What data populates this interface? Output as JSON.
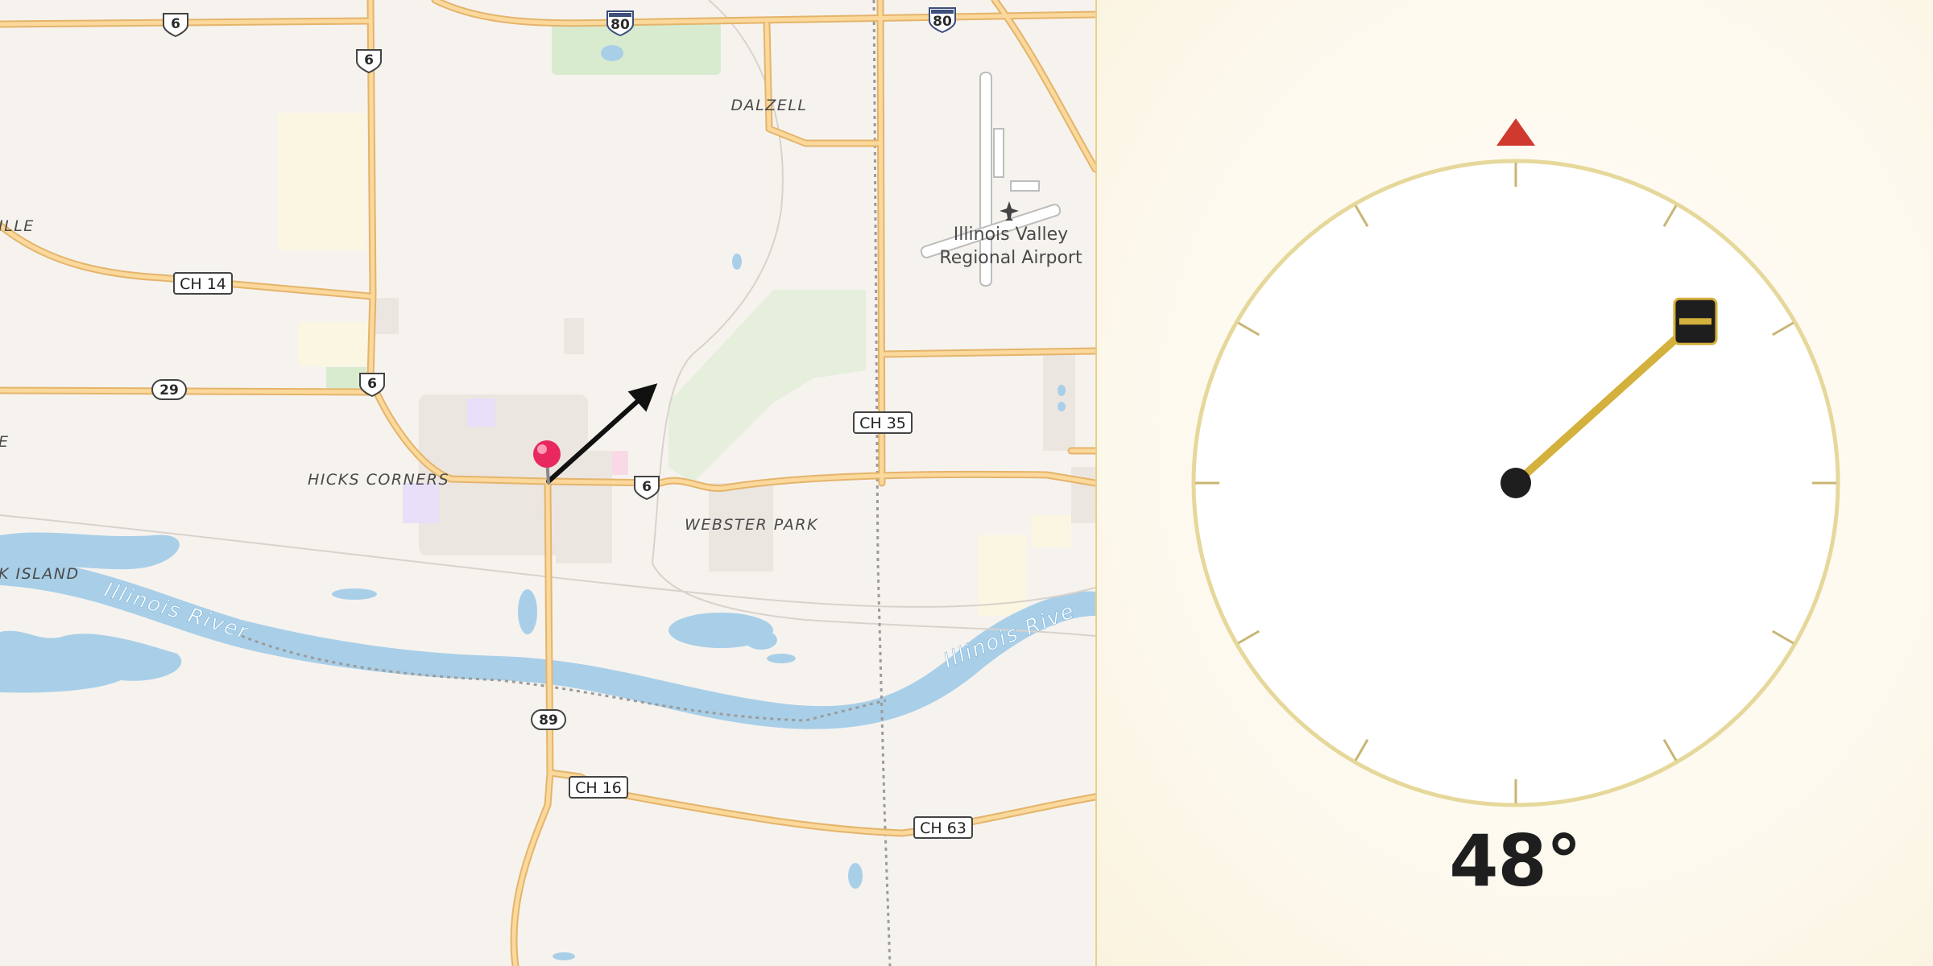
{
  "map": {
    "places": {
      "dalzell": "DALZELL",
      "hicks_corners": "HICKS CORNERS",
      "webster_park": "WEBSTER PARK",
      "ille": "ILLE",
      "e": "E",
      "k_island": "K ISLAND"
    },
    "airport": {
      "line1": "Illinois Valley",
      "line2": "Regional Airport"
    },
    "river": {
      "name": "Illinois River",
      "name_right": "Illinois Rive"
    },
    "shields": {
      "us6": "6",
      "i80": "80",
      "r29": "29",
      "r89": "89"
    },
    "county_roads": {
      "ch14": "CH 14",
      "ch35": "CH 35",
      "ch16": "CH 16",
      "ch63": "CH 63"
    },
    "marker": {
      "color": "#e8285f",
      "icon": "map-pin-icon"
    },
    "direction_arrow": {
      "icon": "arrow-icon",
      "color": "#111111"
    }
  },
  "compass": {
    "heading_deg": 48,
    "heading_label": "48°",
    "north_marker_color": "#d03a2e",
    "needle_color": "#d4b03c",
    "ring_color": "#e6d89b",
    "tick_color": "#c9b675",
    "hub_color": "#1e1e1e"
  }
}
